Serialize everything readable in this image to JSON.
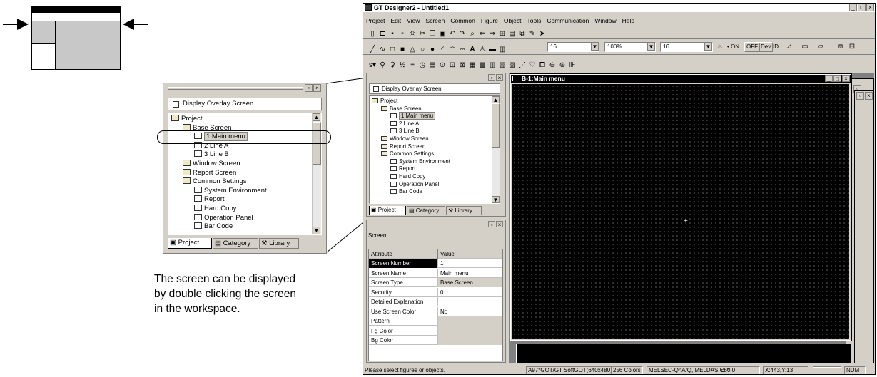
{
  "diagram": {
    "arrows": [
      "right-arrow",
      "left-arrow"
    ]
  },
  "zoom_panel": {
    "overlay_label": "Display Overlay Screen",
    "tree": [
      {
        "label": "Project",
        "level": 0,
        "icon": "project-icon"
      },
      {
        "label": "Base Screen",
        "level": 1,
        "icon": "folder-icon"
      },
      {
        "label": "1 Main menu",
        "level": 2,
        "icon": "screen-icon",
        "selected": true
      },
      {
        "label": "2 Line A",
        "level": 2,
        "icon": "screen-icon"
      },
      {
        "label": "3 Line B",
        "level": 2,
        "icon": "screen-icon"
      },
      {
        "label": "Window Screen",
        "level": 1,
        "icon": "folder-icon"
      },
      {
        "label": "Report Screen",
        "level": 1,
        "icon": "folder-icon"
      },
      {
        "label": "Common Settings",
        "level": 1,
        "icon": "folder-icon"
      },
      {
        "label": "System Environment",
        "level": 2,
        "icon": "system-icon"
      },
      {
        "label": "Report",
        "level": 2,
        "icon": "report-icon"
      },
      {
        "label": "Hard Copy",
        "level": 2,
        "icon": "hardcopy-icon"
      },
      {
        "label": "Operation Panel",
        "level": 2,
        "icon": "panel-icon"
      },
      {
        "label": "Bar Code",
        "level": 2,
        "icon": "barcode-icon"
      }
    ],
    "tabs": [
      "Project",
      "Category",
      "Library"
    ]
  },
  "caption": {
    "line1": "The screen can be displayed",
    "line2": "by double clicking the screen",
    "line3": "in the workspace."
  },
  "app": {
    "title": "GT Designer2 - Untitled1",
    "menus": [
      "Project",
      "Edit",
      "View",
      "Screen",
      "Common",
      "Figure",
      "Object",
      "Tools",
      "Communication",
      "Window",
      "Help"
    ],
    "toolbar2": {
      "line_width": "16",
      "zoom": "100%",
      "font_size": "16",
      "on_label": "ON",
      "off_label": "OFF",
      "dev_label": "Dev",
      "id_label": "ID"
    },
    "workspace": {
      "overlay_label": "Display Overlay Screen",
      "tree": [
        {
          "label": "Project",
          "level": 0
        },
        {
          "label": "Base Screen",
          "level": 1
        },
        {
          "label": "1 Main menu",
          "level": 2,
          "selected": true
        },
        {
          "label": "2 Line A",
          "level": 2
        },
        {
          "label": "3 Line B",
          "level": 2
        },
        {
          "label": "Window Screen",
          "level": 1
        },
        {
          "label": "Report Screen",
          "level": 1
        },
        {
          "label": "Common Settings",
          "level": 1
        },
        {
          "label": "System Environment",
          "level": 2
        },
        {
          "label": "Report",
          "level": 2
        },
        {
          "label": "Hard Copy",
          "level": 2
        },
        {
          "label": "Operation Panel",
          "level": 2
        },
        {
          "label": "Bar Code",
          "level": 2
        }
      ],
      "tabs": [
        "Project",
        "Category",
        "Library"
      ]
    },
    "properties": {
      "title": "Screen",
      "header_attr": "Attribute",
      "header_value": "Value",
      "rows": [
        {
          "attr": "Screen Number",
          "value": "1",
          "highlight_attr": true
        },
        {
          "attr": "Screen Name",
          "value": "Main menu"
        },
        {
          "attr": "Screen Type",
          "value": "Base Screen",
          "gray_value": true
        },
        {
          "attr": "Security",
          "value": "0"
        },
        {
          "attr": "Detailed Explanation",
          "value": ""
        },
        {
          "attr": "Use Screen Color",
          "value": "No"
        },
        {
          "attr": "Pattern",
          "value": "",
          "gray_value": true
        },
        {
          "attr": "Fg Color",
          "value": "",
          "gray_value": true
        },
        {
          "attr": "Bg Color",
          "value": "",
          "gray_value": true
        }
      ]
    },
    "screen_window": {
      "title": "B-1:Main menu"
    },
    "status": {
      "message": "Please select figures or objects.",
      "got_type": "A97*GOT/GT SoftGOT(640x480)",
      "colors": "256 Colors",
      "plc": "MELSEC-QnA/Q, MELDAS C6*",
      "offset": "0,0",
      "coords": "X:443,Y:13",
      "num": "NUM"
    }
  }
}
